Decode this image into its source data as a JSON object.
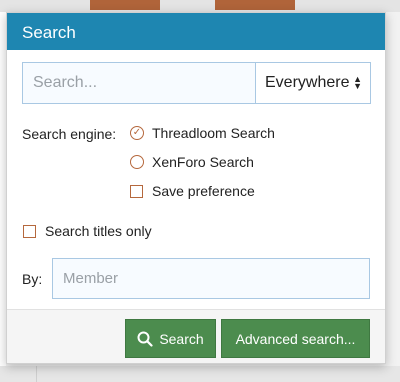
{
  "popup": {
    "title": "Search"
  },
  "search": {
    "placeholder": "Search...",
    "scope_value": "Everywhere"
  },
  "engine": {
    "label": "Search engine:",
    "options": [
      {
        "label": "Threadloom Search",
        "selected": true
      },
      {
        "label": "XenForo Search",
        "selected": false
      }
    ],
    "save_preference_label": "Save preference"
  },
  "titles_only_label": "Search titles only",
  "by": {
    "label": "By:",
    "placeholder": "Member"
  },
  "buttons": {
    "search_label": "Search",
    "advanced_label": "Advanced search..."
  },
  "icons": {
    "search": "search-icon",
    "select_arrows": "select-arrows-icon",
    "radio_checked": "check-icon"
  },
  "colors": {
    "header": "#1e86b1",
    "button": "#4c8c4e",
    "control_accent": "#b5683d",
    "input_border": "#a9c8e3"
  }
}
